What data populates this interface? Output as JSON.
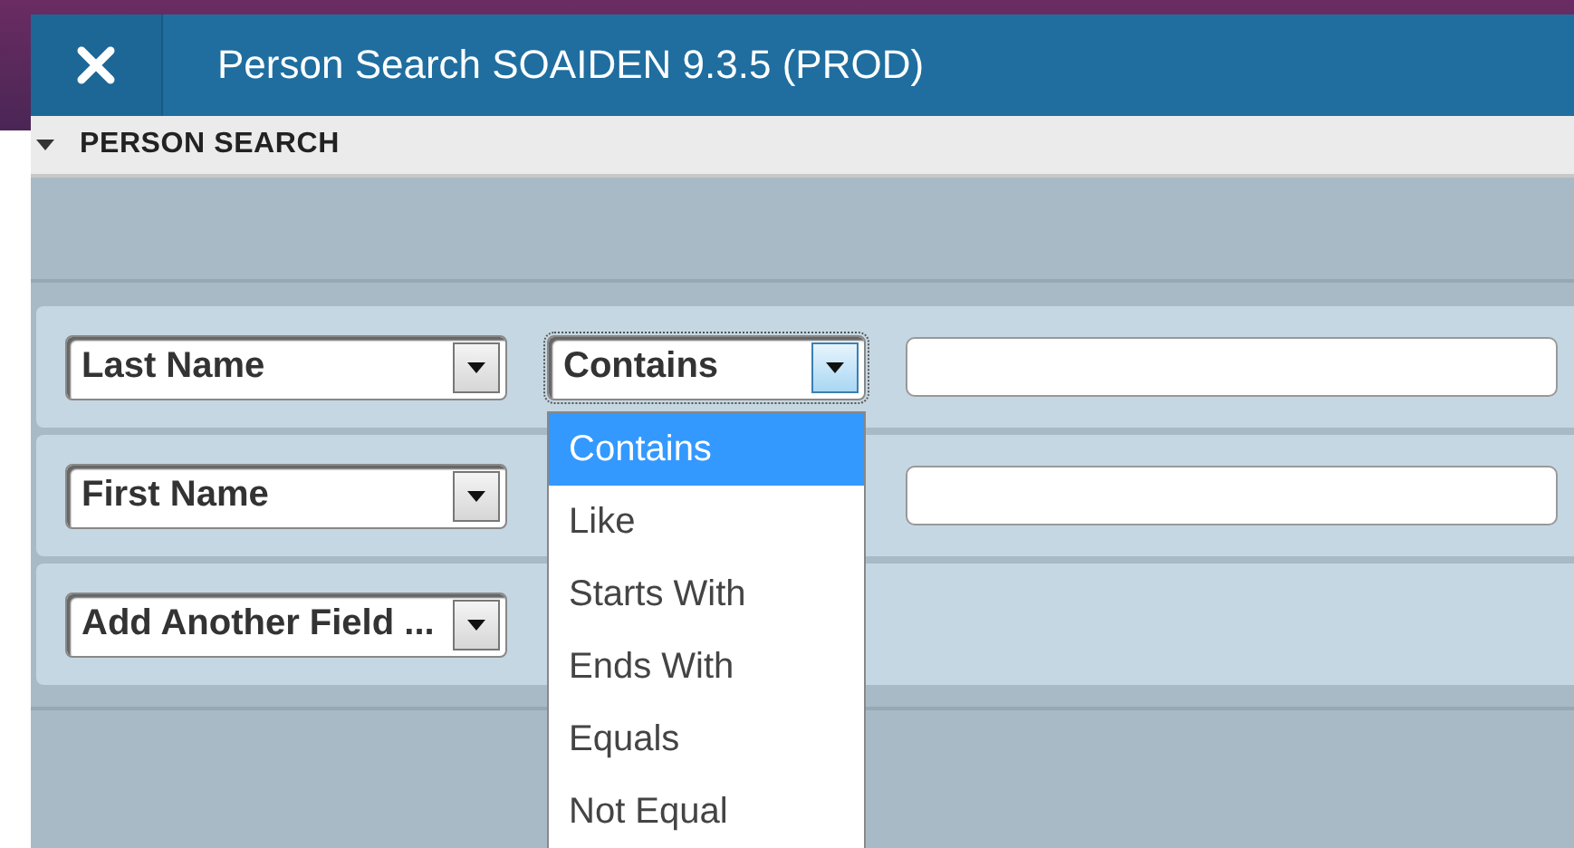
{
  "window": {
    "title": "Person Search SOAIDEN 9.3.5 (PROD)"
  },
  "section": {
    "title": "PERSON SEARCH",
    "expanded": true
  },
  "criteria": [
    {
      "kind": "criterion",
      "field": "Last Name",
      "operator": "Contains",
      "open": true,
      "options": [
        {
          "label": "Contains",
          "selected": true
        },
        {
          "label": "Like",
          "selected": false
        },
        {
          "label": "Starts With",
          "selected": false
        },
        {
          "label": "Ends With",
          "selected": false
        },
        {
          "label": "Equals",
          "selected": false
        },
        {
          "label": "Not Equal",
          "selected": false
        }
      ]
    },
    {
      "kind": "criterion",
      "field": "First Name"
    },
    {
      "kind": "add",
      "field": "Add Another Field ..."
    }
  ]
}
